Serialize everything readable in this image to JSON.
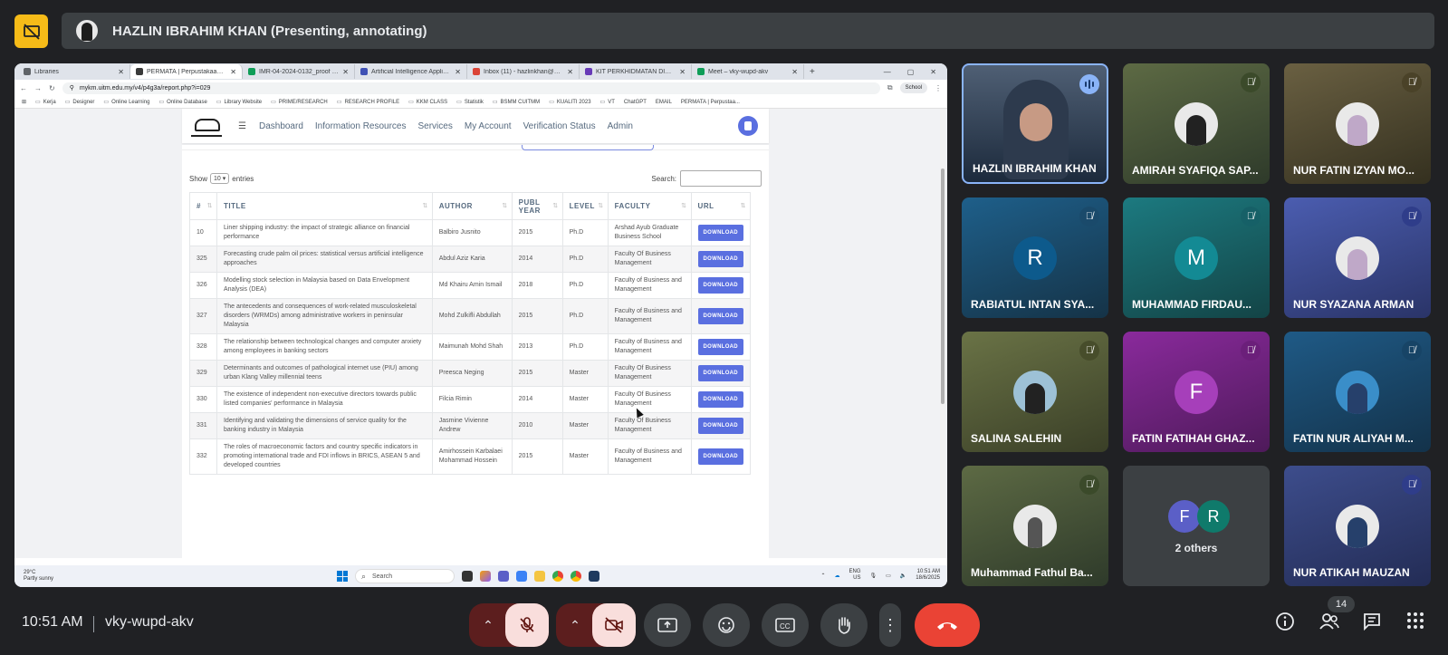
{
  "meeting": {
    "presenter_banner": "HAZLIN IBRAHIM KHAN (Presenting, annotating)",
    "time": "10:51 AM",
    "code": "vky-wupd-akv",
    "participant_count": "14"
  },
  "browser": {
    "tabs": [
      {
        "title": "Libraries",
        "color": "#5f6368"
      },
      {
        "title": "PERMATA | Perpustakaan Tun A",
        "color": "#3a3a3a"
      },
      {
        "title": "IMR-04-2024-0132_proof 1-40",
        "color": "#0f9d58"
      },
      {
        "title": "Artificial Intelligence Applied to",
        "color": "#3f51b5"
      },
      {
        "title": "Inbox (11) - hazlinkhan@uitm.e",
        "color": "#db4437"
      },
      {
        "title": "KIT PERKHIDMATAN DIGITAL P",
        "color": "#673ab7"
      },
      {
        "title": "Meet – vky-wupd-akv",
        "color": "#0f9d58"
      }
    ],
    "url": "mykm.uitm.edu.my/v4/p4g3a/report.php?i=029",
    "profile": "School",
    "bookmarks": [
      "Kerja",
      "Designer",
      "Online Learning",
      "Online Database",
      "Library Website",
      "PRIME/RESEARCH",
      "RESEARCH PROFILE",
      "KKM CLASS",
      "Statistik",
      "BSMM CUITMM",
      "KUALITI 2023",
      "VT",
      "ChatGPT",
      "EMAIL",
      "PERMATA | Perpustaa..."
    ]
  },
  "site": {
    "nav": [
      "Dashboard",
      "Information Resources",
      "Services",
      "My Account",
      "Verification Status",
      "Admin"
    ],
    "show_label": "Show",
    "entries_value": "10",
    "entries_label": "entries",
    "search_label": "Search:"
  },
  "table": {
    "headers": [
      "#",
      "TITLE",
      "AUTHOR",
      "PUBL YEAR",
      "LEVEL",
      "FACULTY",
      "URL"
    ],
    "button_label": "DOWNLOAD",
    "rows": [
      {
        "num": "10",
        "title": "Liner shipping industry: the impact of strategic alliance on financial performance",
        "author": "Balbiro Jusnito",
        "year": "2015",
        "level": "Ph.D",
        "faculty": "Arshad Ayub Graduate Business School"
      },
      {
        "num": "325",
        "title": "Forecasting crude palm oil prices: statistical versus artificial intelligence approaches",
        "author": "Abdul Aziz Karia",
        "year": "2014",
        "level": "Ph.D",
        "faculty": "Faculty Of Business Management"
      },
      {
        "num": "326",
        "title": "Modelling stock selection in Malaysia based on Data Envelopment Analysis (DEA)",
        "author": "Md Khairu Amin Ismail",
        "year": "2018",
        "level": "Ph.D",
        "faculty": "Faculty of Business and Management"
      },
      {
        "num": "327",
        "title": "The antecedents and consequences of work-related musculoskeletal disorders (WRMDs) among administrative workers in peninsular Malaysia",
        "author": "Mohd Zulkifli Abdullah",
        "year": "2015",
        "level": "Ph.D",
        "faculty": "Faculty of Business and Management"
      },
      {
        "num": "328",
        "title": "The relationship between technological changes and computer anxiety among employees in banking sectors",
        "author": "Maimunah Mohd Shah",
        "year": "2013",
        "level": "Ph.D",
        "faculty": "Faculty of Business and Management"
      },
      {
        "num": "329",
        "title": "Determinants and outcomes of pathological internet use (PIU) among urban Klang Valley millennial teens",
        "author": "Preesca Neging",
        "year": "2015",
        "level": "Master",
        "faculty": "Faculty Of Business Management"
      },
      {
        "num": "330",
        "title": "The existence of independent non-executive directors towards public listed companies' performance in Malaysia",
        "author": "Filcia Rimin",
        "year": "2014",
        "level": "Master",
        "faculty": "Faculty Of Business Management"
      },
      {
        "num": "331",
        "title": "Identifying and validating the dimensions of service quality for the banking industry in Malaysia",
        "author": "Jasmine Vivienne Andrew",
        "year": "2010",
        "level": "Master",
        "faculty": "Faculty Of Business Management"
      },
      {
        "num": "332",
        "title": "The roles of macroeconomic factors and country specific indicators in promoting international trade and FDI inflows in BRICS, ASEAN 5 and developed countries",
        "author": "Amirhossein Karbalaei Mohammad Hossein",
        "year": "2015",
        "level": "Master",
        "faculty": "Faculty of Business and Management"
      }
    ]
  },
  "taskbar": {
    "temp": "29°C",
    "weather": "Partly sunny",
    "search": "Search",
    "lang": "ENG",
    "region": "US",
    "time": "10:51 AM",
    "date": "18/6/2025"
  },
  "participants": [
    {
      "name": "HAZLIN IBRAHIM KHAN"
    },
    {
      "name": "AMIRAH SYAFIQA SAP..."
    },
    {
      "name": "NUR FATIN IZYAN MO..."
    },
    {
      "name": "RABIATUL INTAN SYA...",
      "initial": "R"
    },
    {
      "name": "MUHAMMAD FIRDAU...",
      "initial": "M"
    },
    {
      "name": "NUR SYAZANA ARMAN"
    },
    {
      "name": "SALINA SALEHIN"
    },
    {
      "name": "FATIN FATIHAH GHAZ...",
      "initial": "F"
    },
    {
      "name": "FATIN NUR ALIYAH M..."
    },
    {
      "name": "Muhammad Fathul Ba..."
    },
    {
      "name": "2 others",
      "initials": [
        "F",
        "R"
      ]
    },
    {
      "name": "NUR ATIKAH MAUZAN"
    }
  ],
  "colors": {
    "meet_bg": "#202124",
    "hangup": "#ea4335",
    "download_btn": "#5a6fe0",
    "presenter_highlight": "#8ab4f8"
  }
}
